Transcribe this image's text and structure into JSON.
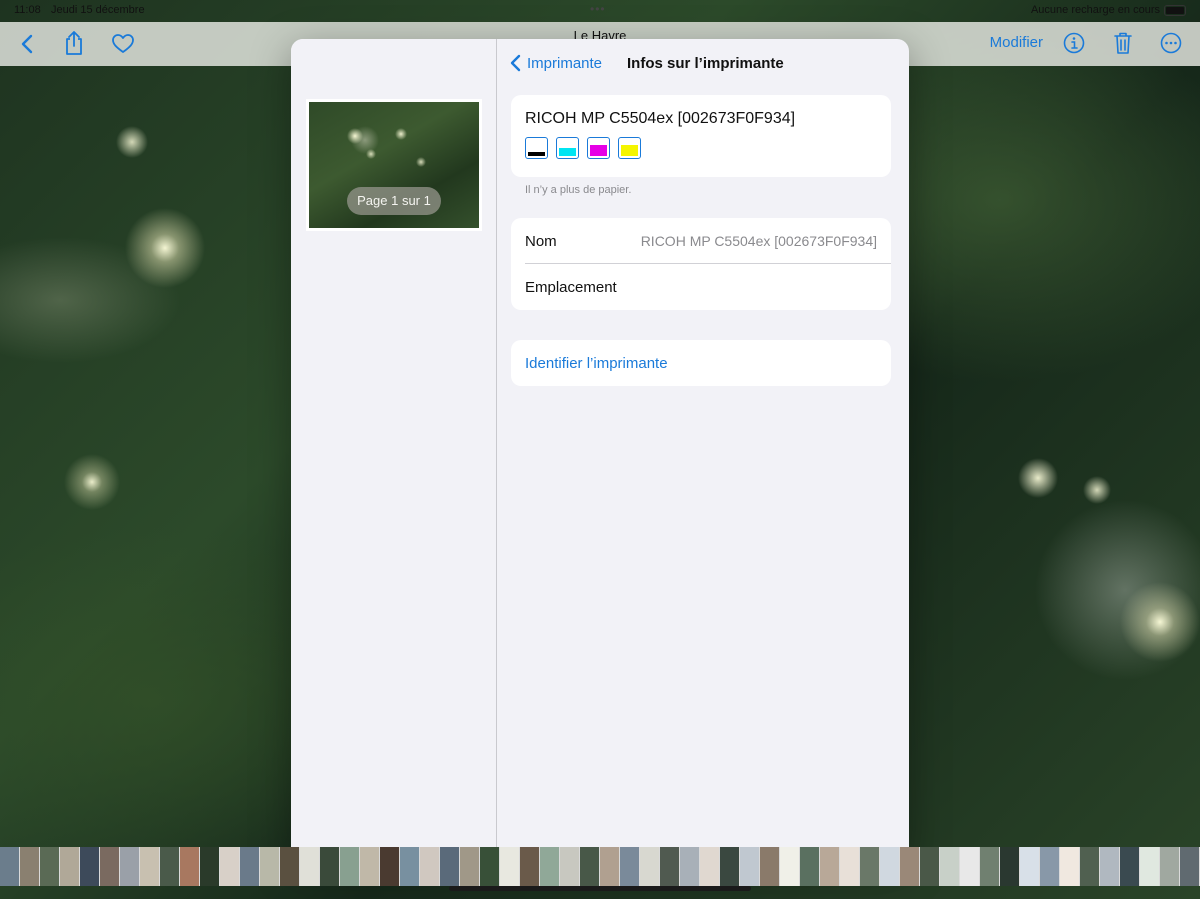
{
  "status_bar": {
    "time": "11:08",
    "date": "Jeudi 15 décembre",
    "charging": "Aucune recharge en cours"
  },
  "top_bar": {
    "title": "Le Havre",
    "modify_label": "Modifier",
    "icons": [
      "back-chevron-icon",
      "share-icon",
      "heart-icon",
      "info-icon",
      "trash-icon",
      "more-icon"
    ]
  },
  "preview": {
    "page_badge": "Page 1 sur 1"
  },
  "panel": {
    "back_label": "Imprimante",
    "title": "Infos sur l’imprimante",
    "printer_name": "RICOH MP C5504ex [002673F0F934]",
    "inks": [
      {
        "name": "black",
        "color": "#000000",
        "level": 0.2
      },
      {
        "name": "cyan",
        "color": "#00e5f2",
        "level": 0.45
      },
      {
        "name": "magenta",
        "color": "#e600e6",
        "level": 0.6
      },
      {
        "name": "yellow",
        "color": "#f5f500",
        "level": 0.6
      }
    ],
    "paper_note": "Il n’y a plus de papier.",
    "name_label": "Nom",
    "name_value": "RICOH MP C5504ex [002673F0F934]",
    "location_label": "Emplacement",
    "identify_label": "Identifier l’imprimante"
  },
  "colors": {
    "accent": "#1a7ad9",
    "sheet_bg": "#f2f2f7",
    "secondary_text": "#8a8a8e"
  },
  "thumbnails": [
    "#6b7d8c",
    "#8a8070",
    "#5a6a55",
    "#b0a898",
    "#3d4a5a",
    "#7a6a60",
    "#9aa0a8",
    "#c8c0b0",
    "#4a5a4a",
    "#a87860",
    "#2a3a2a",
    "#d8d0c8",
    "#6a7a8a",
    "#b8b8a8",
    "#5a5040",
    "#e0e0d8",
    "#3a4a3a",
    "#88a090",
    "#c0b8a8",
    "#4a3a30",
    "#7890a0",
    "#d0c8c0",
    "#5a6a7a",
    "#a09888",
    "#385038",
    "#e8e8e0",
    "#6a5a4a",
    "#90a898",
    "#c8c8c0",
    "#485848",
    "#b0a090",
    "#7a8a9a",
    "#d8d8d0",
    "#505a50",
    "#a8b0b8",
    "#e0d8d0",
    "#3a4840",
    "#c0c8d0",
    "#8a7a6a",
    "#f0f0e8",
    "#5a7060",
    "#b8a898",
    "#e8e0d8",
    "#6a7868",
    "#d0d8e0",
    "#9a8878",
    "#4a5848",
    "#c8d0c8",
    "#e8e8e8",
    "#708070",
    "#2a3830",
    "#d8e0e8",
    "#8898a8",
    "#f0e8e0",
    "#506050",
    "#b0b8c0",
    "#3a4a50",
    "#e0e8e0",
    "#a0a8a0",
    "#606a70",
    "#c8c0b8",
    "#405040",
    "#f0f0f0",
    "#8090a0",
    "#d0d0c8",
    "#283830",
    "#b8c0c8",
    "#e8e0e0",
    "#607060",
    "#a8a098",
    "#1a2a2a",
    "#d8e8d8",
    "#7888a0",
    "#f0e8e8",
    "#4a6050",
    "#c0c8c0",
    "#98a0a8",
    "#2a3a30",
    "#e0e0e8",
    "#708878",
    "#b8b0a8",
    "#3a5048",
    "#d0d8d0",
    "#687880",
    "#f0f0e0",
    "#9898a0",
    "#485050",
    "#c8d0d0",
    "#a8b8c8",
    "#1a2030",
    "#e8f0f0",
    "#587068",
    "#d0c8c0",
    "#7a8a88",
    "#303a38",
    "#c0c0c8",
    "#a09890",
    "#e0e8e8",
    "#587890",
    "#f0e0d8",
    "#8090a0"
  ]
}
